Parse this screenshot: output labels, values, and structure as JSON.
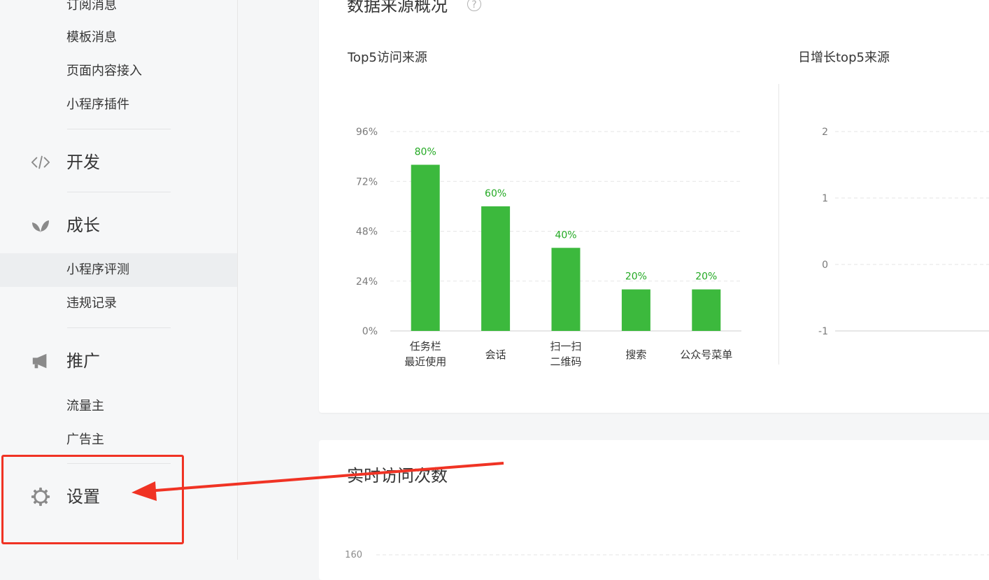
{
  "sidebar": {
    "items": [
      {
        "label": "订阅消息"
      },
      {
        "label": "模板消息"
      },
      {
        "label": "页面内容接入"
      },
      {
        "label": "小程序插件"
      }
    ],
    "sections": {
      "dev": {
        "label": "开发",
        "icon": "code-icon"
      },
      "growth": {
        "label": "成长",
        "icon": "sprout-icon",
        "items": [
          {
            "label": "小程序评测",
            "active": true
          },
          {
            "label": "违规记录"
          }
        ]
      },
      "promo": {
        "label": "推广",
        "icon": "megaphone-icon",
        "items": [
          {
            "label": "流量主"
          },
          {
            "label": "广告主"
          }
        ]
      },
      "settings": {
        "label": "设置",
        "icon": "gear-icon"
      }
    }
  },
  "overview": {
    "title": "数据来源概况",
    "help_icon": "?",
    "left_title": "Top5访问来源",
    "right_title": "日增长top5来源"
  },
  "realtime": {
    "title": "实时访问次数",
    "first_tick": "160"
  },
  "colors": {
    "bar": "#3cb93d",
    "bar_label": "#23a923",
    "annotation": "#f03324"
  },
  "chart_data": [
    {
      "type": "bar",
      "title": "Top5访问来源",
      "categories": [
        [
          "任务栏",
          "最近使用"
        ],
        [
          "会话"
        ],
        [
          "扫一扫",
          "二维码"
        ],
        [
          "搜索"
        ],
        [
          "公众号菜单"
        ]
      ],
      "values": [
        80,
        60,
        40,
        20,
        20
      ],
      "value_labels": [
        "80%",
        "60%",
        "40%",
        "20%",
        "20%"
      ],
      "yticks": [
        "0%",
        "24%",
        "48%",
        "72%",
        "96%"
      ],
      "ylim": [
        0,
        96
      ],
      "grid": true
    },
    {
      "type": "line",
      "title": "日增长top5来源",
      "yticks": [
        "-1",
        "0",
        "1",
        "2"
      ],
      "ylim": [
        -1,
        2
      ],
      "grid": true
    }
  ]
}
